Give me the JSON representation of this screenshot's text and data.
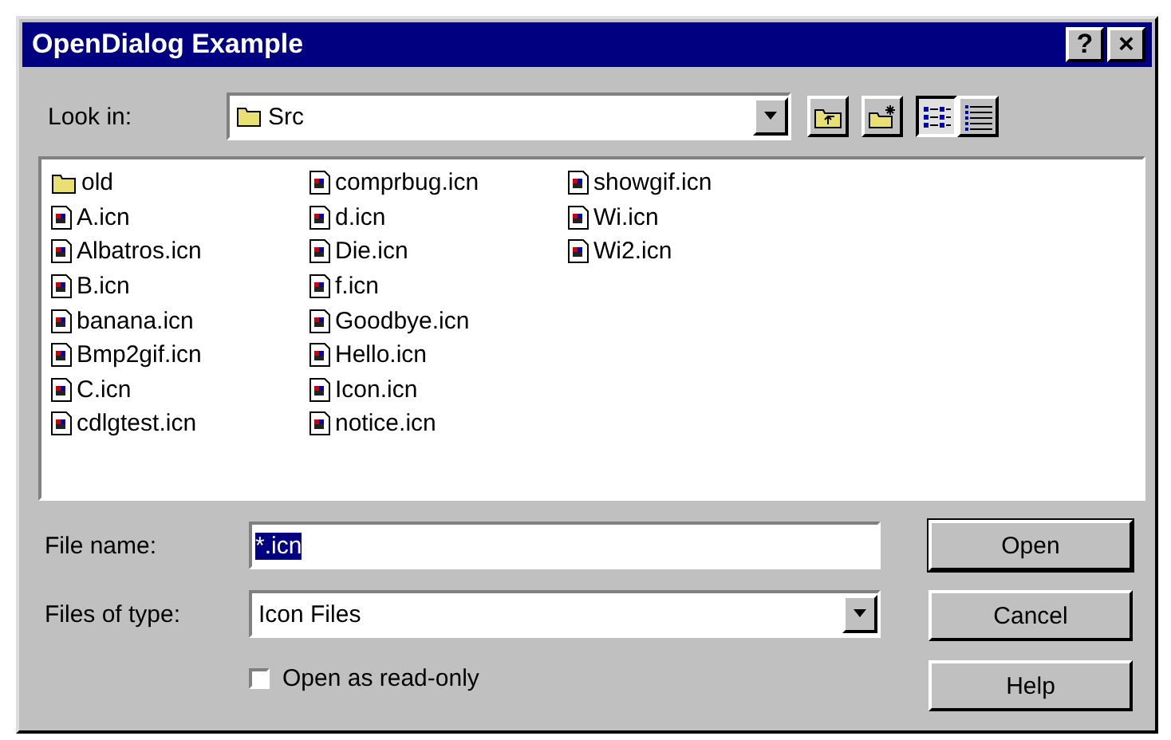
{
  "window": {
    "title": "OpenDialog Example",
    "title_buttons": [
      "?",
      "×"
    ]
  },
  "look_in": {
    "label": "Look in:",
    "value": "Src"
  },
  "view_buttons": [
    {
      "kind": "list",
      "selected": true
    },
    {
      "kind": "details",
      "selected": false
    }
  ],
  "files": [
    {
      "name": "old",
      "kind": "folder"
    },
    {
      "name": "A.icn",
      "kind": "file"
    },
    {
      "name": "Albatros.icn",
      "kind": "file"
    },
    {
      "name": "B.icn",
      "kind": "file"
    },
    {
      "name": "banana.icn",
      "kind": "file"
    },
    {
      "name": "Bmp2gif.icn",
      "kind": "file"
    },
    {
      "name": "C.icn",
      "kind": "file"
    },
    {
      "name": "cdlgtest.icn",
      "kind": "file"
    },
    {
      "name": "comprbug.icn",
      "kind": "file"
    },
    {
      "name": "d.icn",
      "kind": "file"
    },
    {
      "name": "Die.icn",
      "kind": "file"
    },
    {
      "name": "f.icn",
      "kind": "file"
    },
    {
      "name": "Goodbye.icn",
      "kind": "file"
    },
    {
      "name": "Hello.icn",
      "kind": "file"
    },
    {
      "name": "Icon.icn",
      "kind": "file"
    },
    {
      "name": "notice.icn",
      "kind": "file"
    },
    {
      "name": "showgif.icn",
      "kind": "file"
    },
    {
      "name": "Wi.icn",
      "kind": "file"
    },
    {
      "name": "Wi2.icn",
      "kind": "file"
    }
  ],
  "file_name": {
    "label": "File name:",
    "value": "*.icn"
  },
  "file_type": {
    "label": "Files of type:",
    "value": "Icon Files"
  },
  "read_only": {
    "label": "Open as read-only",
    "checked": false
  },
  "buttons": [
    "Open",
    "Cancel",
    "Help"
  ]
}
